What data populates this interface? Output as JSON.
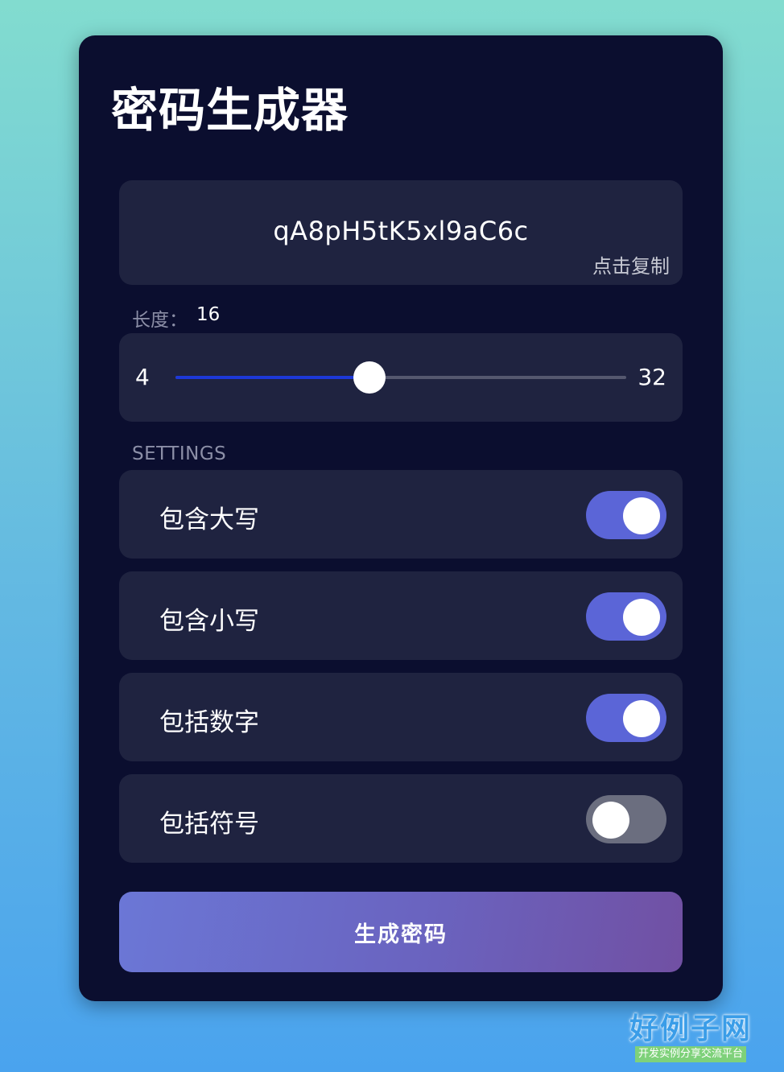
{
  "app": {
    "title": "密码生成器"
  },
  "output": {
    "password": "qA8pH5tK5xl9aC6c",
    "copy_hint": "点击复制"
  },
  "length": {
    "label": "长度：",
    "value": "16",
    "min": "4",
    "max": "32",
    "fill_fraction": 0.43
  },
  "settings": {
    "heading": "SETTINGS",
    "options": [
      {
        "label": "包含大写",
        "enabled": true
      },
      {
        "label": "包含小写",
        "enabled": true
      },
      {
        "label": "包括数字",
        "enabled": true
      },
      {
        "label": "包括符号",
        "enabled": false
      }
    ]
  },
  "actions": {
    "generate_label": "生成密码"
  },
  "watermark": {
    "brand": "好例子网",
    "tagline": "开发实例分享交流平台"
  },
  "colors": {
    "card_background": "#0b0e2f",
    "panel_background": "#1f2340",
    "toggle_on": "#5b65d7",
    "toggle_off": "#6b6e7f",
    "slider_fill": "#1d38d8",
    "button_gradient_start": "#6b77d6",
    "button_gradient_end": "#7150a3"
  }
}
